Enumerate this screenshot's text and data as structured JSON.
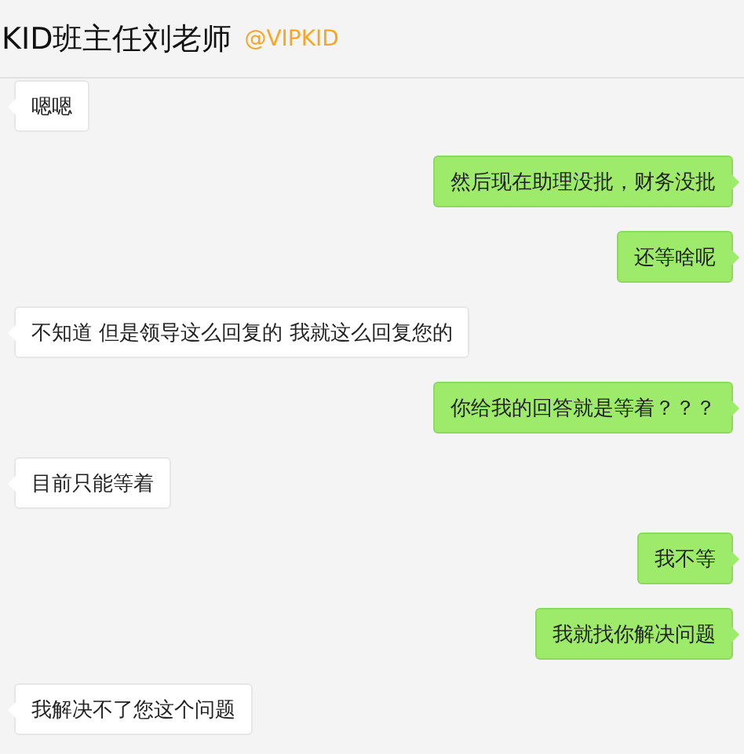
{
  "header": {
    "title": "KID班主任刘老师",
    "account": "@VIPKID"
  },
  "messages": [
    {
      "kind": "received",
      "text": "嗯嗯"
    },
    {
      "kind": "sent",
      "text": "然后现在助理没批，财务没批"
    },
    {
      "kind": "sent",
      "text": "还等啥呢"
    },
    {
      "kind": "received",
      "text": "不知道 但是领导这么回复的 我就这么回复您的"
    },
    {
      "kind": "sent",
      "text": "你给我的回答就是等着？？？"
    },
    {
      "kind": "received",
      "text": "目前只能等着"
    },
    {
      "kind": "sent",
      "text": "我不等"
    },
    {
      "kind": "sent",
      "text": "我就找你解决问题"
    },
    {
      "kind": "received",
      "text": "我解决不了您这个问题"
    }
  ]
}
